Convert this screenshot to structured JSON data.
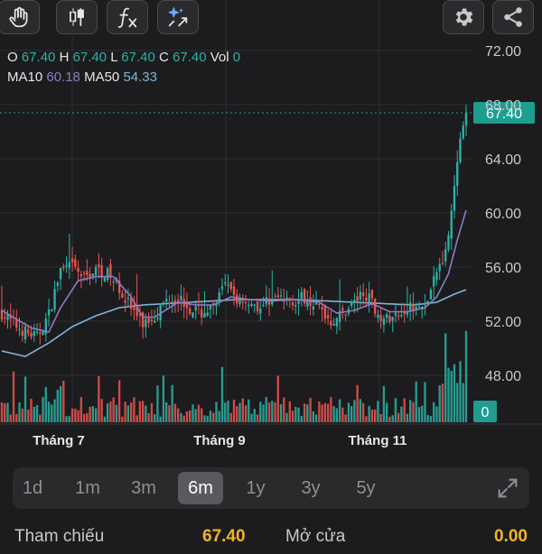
{
  "toolbar": {
    "icons": [
      "hand-icon",
      "candlestick-icon",
      "function-icon",
      "magic-icon",
      "settings-icon",
      "share-icon"
    ]
  },
  "legend": {
    "o_label": "O",
    "o_value": "67.40",
    "h_label": "H",
    "h_value": "67.40",
    "l_label": "L",
    "l_value": "67.40",
    "c_label": "C",
    "c_value": "67.40",
    "vol_label": "Vol",
    "vol_value": "0",
    "ma10_label": "MA10",
    "ma10_value": "60.18",
    "ma50_label": "MA50",
    "ma50_value": "54.33"
  },
  "colors": {
    "up": "#2ab3a6",
    "down": "#ef5350",
    "ma10": "#8e7cc3",
    "ma50": "#7fb4d8",
    "price_tag": "#1e9e90"
  },
  "chart_data": {
    "type": "candlestick",
    "y_ticks": [
      "72.00",
      "68.00",
      "64.00",
      "60.00",
      "56.00",
      "52.00",
      "48.00"
    ],
    "ylim": [
      45.6,
      73.2
    ],
    "x_ticks": [
      "Tháng 7",
      "Tháng 9",
      "Tháng 11"
    ],
    "last_price": "67.40",
    "last_volume": "0",
    "grid": true,
    "price_anchors": [
      [
        0,
        52.6
      ],
      [
        4,
        51.8
      ],
      [
        8,
        51.2
      ],
      [
        12,
        50.8
      ],
      [
        16,
        52.5
      ],
      [
        20,
        55.8
      ],
      [
        24,
        56.0
      ],
      [
        28,
        55.2
      ],
      [
        32,
        55.8
      ],
      [
        36,
        55.5
      ],
      [
        40,
        54.5
      ],
      [
        44,
        53.0
      ],
      [
        48,
        51.8
      ],
      [
        52,
        52.4
      ],
      [
        56,
        53.6
      ],
      [
        60,
        53.8
      ],
      [
        64,
        53.0
      ],
      [
        68,
        52.6
      ],
      [
        72,
        53.0
      ],
      [
        76,
        54.6
      ],
      [
        80,
        53.6
      ],
      [
        84,
        53.5
      ],
      [
        88,
        53.0
      ],
      [
        92,
        53.8
      ],
      [
        96,
        53.5
      ],
      [
        100,
        53.6
      ],
      [
        104,
        53.8
      ],
      [
        108,
        53.0
      ],
      [
        112,
        52.0
      ],
      [
        116,
        52.6
      ],
      [
        120,
        53.5
      ],
      [
        124,
        54.0
      ],
      [
        128,
        52.6
      ],
      [
        132,
        52.0
      ],
      [
        136,
        52.8
      ],
      [
        140,
        53.2
      ],
      [
        144,
        53.0
      ],
      [
        148,
        55.5
      ],
      [
        152,
        58.0
      ],
      [
        154,
        62.0
      ],
      [
        156,
        65.5
      ],
      [
        158,
        67.4
      ]
    ],
    "ma10_anchors": [
      [
        0,
        52.8
      ],
      [
        10,
        51.5
      ],
      [
        16,
        51.2
      ],
      [
        20,
        53.0
      ],
      [
        26,
        55.0
      ],
      [
        32,
        55.3
      ],
      [
        38,
        55.3
      ],
      [
        44,
        53.8
      ],
      [
        48,
        52.3
      ],
      [
        52,
        52.3
      ],
      [
        60,
        53.4
      ],
      [
        66,
        53.2
      ],
      [
        72,
        53.2
      ],
      [
        78,
        53.8
      ],
      [
        84,
        53.6
      ],
      [
        92,
        53.5
      ],
      [
        100,
        53.6
      ],
      [
        108,
        53.4
      ],
      [
        114,
        52.6
      ],
      [
        120,
        52.8
      ],
      [
        126,
        53.3
      ],
      [
        132,
        52.7
      ],
      [
        138,
        52.7
      ],
      [
        144,
        53.0
      ],
      [
        148,
        53.8
      ],
      [
        152,
        55.5
      ],
      [
        155,
        58.0
      ],
      [
        158,
        60.2
      ]
    ],
    "ma50_anchors": [
      [
        0,
        49.8
      ],
      [
        8,
        49.4
      ],
      [
        16,
        50.4
      ],
      [
        24,
        51.6
      ],
      [
        32,
        52.4
      ],
      [
        40,
        53.0
      ],
      [
        48,
        53.2
      ],
      [
        64,
        53.4
      ],
      [
        80,
        53.6
      ],
      [
        100,
        53.6
      ],
      [
        120,
        53.4
      ],
      [
        140,
        53.2
      ],
      [
        148,
        53.4
      ],
      [
        154,
        54.0
      ],
      [
        158,
        54.33
      ]
    ]
  },
  "periods": [
    "1d",
    "1m",
    "3m",
    "6m",
    "1y",
    "3y",
    "5y"
  ],
  "active_period": "6m",
  "bottom": {
    "ref_label": "Tham chiếu",
    "ref_value": "67.40",
    "open_label": "Mở cửa",
    "open_value": "0.00"
  }
}
